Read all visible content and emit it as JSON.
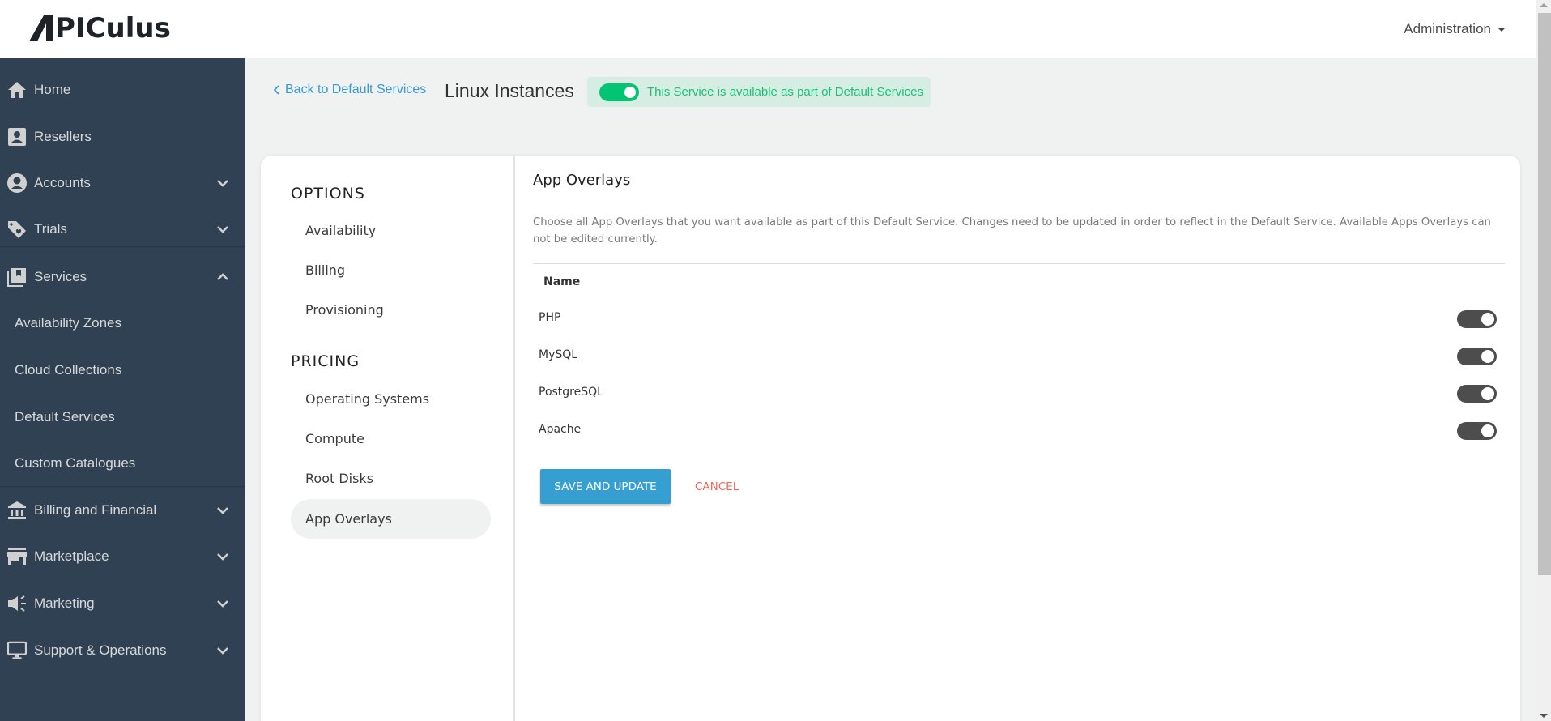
{
  "header": {
    "logo_text": "APICULUS",
    "admin_menu_label": "Administration"
  },
  "sidebar": {
    "items": [
      {
        "label": "Home",
        "icon": "home-icon",
        "expandable": false
      },
      {
        "label": "Resellers",
        "icon": "contact-card-icon",
        "expandable": false
      },
      {
        "label": "Accounts",
        "icon": "account-circle-icon",
        "expandable": true,
        "expanded": false
      },
      {
        "label": "Trials",
        "icon": "tag-heart-icon",
        "expandable": true,
        "expanded": false
      },
      {
        "label": "Services",
        "icon": "library-bookmark-icon",
        "expandable": true,
        "expanded": true
      },
      {
        "label": "Availability Zones",
        "sub": true
      },
      {
        "label": "Cloud Collections",
        "sub": true
      },
      {
        "label": "Default Services",
        "sub": true
      },
      {
        "label": "Custom Catalogues",
        "sub": true
      },
      {
        "label": "Billing and Financial",
        "icon": "bank-icon",
        "expandable": true,
        "expanded": false
      },
      {
        "label": "Marketplace",
        "icon": "store-icon",
        "expandable": true,
        "expanded": false
      },
      {
        "label": "Marketing",
        "icon": "megaphone-icon",
        "expandable": true,
        "expanded": false
      },
      {
        "label": "Support & Operations",
        "icon": "monitor-icon",
        "expandable": true,
        "expanded": false
      }
    ]
  },
  "topbar": {
    "back_label": "Back to Default Services",
    "page_title": "Linux Instances",
    "availability_text": "This Service is available as part of Default Services",
    "availability_enabled": true
  },
  "options_panel": {
    "options_title": "OPTIONS",
    "options_items": [
      "Availability",
      "Billing",
      "Provisioning"
    ],
    "pricing_title": "PRICING",
    "pricing_items": [
      "Operating Systems",
      "Compute",
      "Root Disks",
      "App Overlays"
    ],
    "active_item": "App Overlays"
  },
  "main": {
    "title": "App Overlays",
    "description": "Choose all App Overlays that you want available as part of this Default Service. Changes need to be updated in order to reflect in the Default Service. Available Apps Overlays can not be edited currently.",
    "column_header": "Name",
    "overlays": [
      {
        "name": "PHP",
        "enabled": true
      },
      {
        "name": "MySQL",
        "enabled": true
      },
      {
        "name": "PostgreSQL",
        "enabled": true
      },
      {
        "name": "Apache",
        "enabled": true
      }
    ],
    "save_label": "SAVE AND UPDATE",
    "cancel_label": "CANCEL"
  },
  "colors": {
    "sidebar_bg": "#2f4153",
    "accent_blue": "#369fd2",
    "success_green": "#03c473",
    "cancel_red": "#f0665a"
  }
}
